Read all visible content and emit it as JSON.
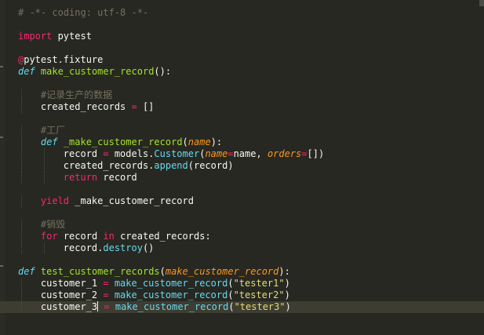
{
  "editor": {
    "lines": [
      [
        {
          "t": "# -*- coding: utf-8 -*-",
          "c": "cm"
        }
      ],
      [],
      [
        {
          "t": "import",
          "c": "kw"
        },
        {
          "t": " pytest",
          "c": ""
        }
      ],
      [],
      [
        {
          "t": "@",
          "c": "kw"
        },
        {
          "t": "pytest.fixture",
          "c": ""
        }
      ],
      [
        {
          "t": "def",
          "c": "dk"
        },
        {
          "t": " ",
          "c": ""
        },
        {
          "t": "make_customer_record",
          "c": "fn"
        },
        {
          "t": "():",
          "c": ""
        }
      ],
      [],
      [
        {
          "t": "    ",
          "c": ""
        },
        {
          "t": "#记录生产的数据",
          "c": "cm"
        }
      ],
      [
        {
          "t": "    created_records ",
          "c": ""
        },
        {
          "t": "=",
          "c": "kw"
        },
        {
          "t": " []",
          "c": ""
        }
      ],
      [],
      [
        {
          "t": "    ",
          "c": ""
        },
        {
          "t": "#工厂",
          "c": "cm"
        }
      ],
      [
        {
          "t": "    ",
          "c": ""
        },
        {
          "t": "def",
          "c": "dk"
        },
        {
          "t": " ",
          "c": ""
        },
        {
          "t": "_make_customer_record",
          "c": "fn"
        },
        {
          "t": "(",
          "c": ""
        },
        {
          "t": "name",
          "c": "pa"
        },
        {
          "t": "):",
          "c": ""
        }
      ],
      [
        {
          "t": "        record ",
          "c": ""
        },
        {
          "t": "=",
          "c": "kw"
        },
        {
          "t": " models.",
          "c": ""
        },
        {
          "t": "Customer",
          "c": "cl"
        },
        {
          "t": "(",
          "c": ""
        },
        {
          "t": "name",
          "c": "pa"
        },
        {
          "t": "=",
          "c": "kw"
        },
        {
          "t": "name, ",
          "c": ""
        },
        {
          "t": "orders",
          "c": "pa"
        },
        {
          "t": "=",
          "c": "kw"
        },
        {
          "t": "[])",
          "c": ""
        }
      ],
      [
        {
          "t": "        created_records.",
          "c": ""
        },
        {
          "t": "append",
          "c": "cl"
        },
        {
          "t": "(record)",
          "c": ""
        }
      ],
      [
        {
          "t": "        ",
          "c": ""
        },
        {
          "t": "return",
          "c": "kw"
        },
        {
          "t": " record",
          "c": ""
        }
      ],
      [],
      [
        {
          "t": "    ",
          "c": ""
        },
        {
          "t": "yield",
          "c": "kw"
        },
        {
          "t": " _make_customer_record",
          "c": ""
        }
      ],
      [],
      [
        {
          "t": "    ",
          "c": ""
        },
        {
          "t": "#销毁",
          "c": "cm"
        }
      ],
      [
        {
          "t": "    ",
          "c": ""
        },
        {
          "t": "for",
          "c": "kw"
        },
        {
          "t": " record ",
          "c": ""
        },
        {
          "t": "in",
          "c": "kw"
        },
        {
          "t": " created_records:",
          "c": ""
        }
      ],
      [
        {
          "t": "        record.",
          "c": ""
        },
        {
          "t": "destroy",
          "c": "cl"
        },
        {
          "t": "()",
          "c": ""
        }
      ],
      [],
      [
        {
          "t": "def",
          "c": "dk"
        },
        {
          "t": " ",
          "c": ""
        },
        {
          "t": "test_customer_records",
          "c": "fn"
        },
        {
          "t": "(",
          "c": ""
        },
        {
          "t": "make_customer_record",
          "c": "pa"
        },
        {
          "t": "):",
          "c": ""
        }
      ],
      [
        {
          "t": "    customer_1 ",
          "c": ""
        },
        {
          "t": "=",
          "c": "kw"
        },
        {
          "t": " make_customer_record",
          "c": "cl"
        },
        {
          "t": "(",
          "c": ""
        },
        {
          "t": "\"tester1\"",
          "c": "st"
        },
        {
          "t": ")",
          "c": ""
        }
      ],
      [
        {
          "t": "    customer_2 ",
          "c": ""
        },
        {
          "t": "=",
          "c": "kw"
        },
        {
          "t": " make_customer_record",
          "c": "cl"
        },
        {
          "t": "(",
          "c": ""
        },
        {
          "t": "\"tester2\"",
          "c": "st"
        },
        {
          "t": ")",
          "c": ""
        }
      ],
      [
        {
          "t": "    customer_3",
          "c": ""
        },
        {
          "t": "",
          "c": "caret"
        },
        {
          "t": " ",
          "c": ""
        },
        {
          "t": "=",
          "c": "kw"
        },
        {
          "t": " make_customer_record",
          "c": "cl"
        },
        {
          "t": "(",
          "c": ""
        },
        {
          "t": "\"tester3\"",
          "c": "st"
        },
        {
          "t": ")",
          "c": ""
        }
      ]
    ]
  },
  "colors": {
    "background": "#272822",
    "foreground": "#f8f8f2",
    "comment": "#75715e",
    "keyword": "#f92672",
    "def_keyword": "#66d9ef",
    "function_name": "#a6e22e",
    "parameter": "#fd971f",
    "string": "#e6db74"
  }
}
